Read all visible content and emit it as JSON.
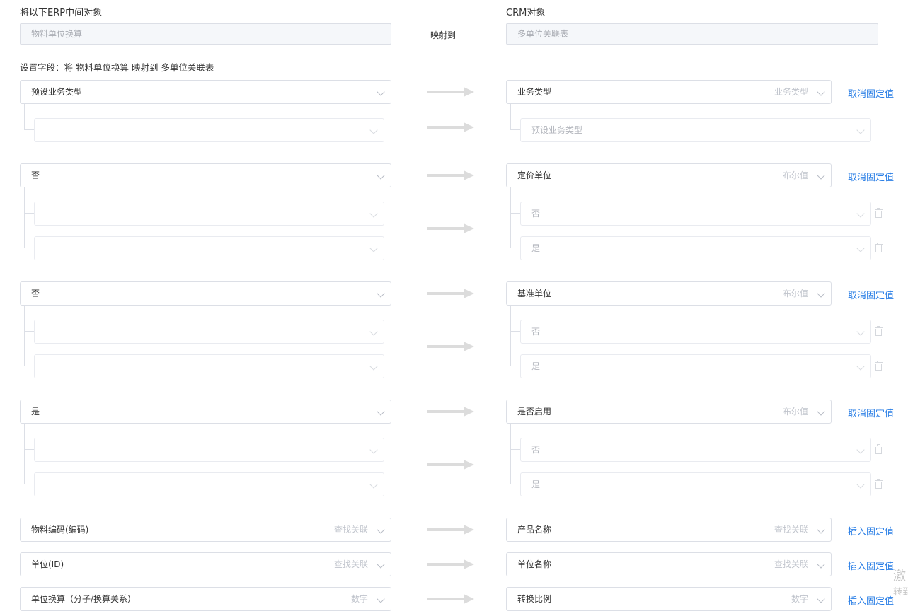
{
  "source_header": "将以下ERP中间对象",
  "target_header": "CRM对象",
  "source_object": "物料单位换算",
  "mapping_label": "映射到",
  "target_object": "多单位关联表",
  "setting_label": "设置字段：将 物料单位换算 映射到 多单位关联表",
  "rows": [
    {
      "source": {
        "value": "预设业务类型",
        "hint": ""
      },
      "target": {
        "value": "业务类型",
        "hint": "业务类型"
      },
      "action": "取消固定值",
      "sub_targets": [
        {
          "value": "预设业务类型",
          "deletable": false
        }
      ]
    },
    {
      "source": {
        "value": "否",
        "hint": ""
      },
      "target": {
        "value": "定价单位",
        "hint": "布尔值"
      },
      "action": "取消固定值",
      "sub_targets": [
        {
          "value": "否",
          "deletable": true
        },
        {
          "value": "是",
          "deletable": true
        }
      ]
    },
    {
      "source": {
        "value": "否",
        "hint": ""
      },
      "target": {
        "value": "基准单位",
        "hint": "布尔值"
      },
      "action": "取消固定值",
      "sub_targets": [
        {
          "value": "否",
          "deletable": true
        },
        {
          "value": "是",
          "deletable": true
        }
      ]
    },
    {
      "source": {
        "value": "是",
        "hint": ""
      },
      "target": {
        "value": "是否启用",
        "hint": "布尔值"
      },
      "action": "取消固定值",
      "sub_targets": [
        {
          "value": "否",
          "deletable": true
        },
        {
          "value": "是",
          "deletable": true
        }
      ]
    },
    {
      "source": {
        "value": "物料编码(编码)",
        "hint": "查找关联"
      },
      "target": {
        "value": "产品名称",
        "hint": "查找关联"
      },
      "action": "插入固定值",
      "sub_targets": []
    },
    {
      "source": {
        "value": "单位(ID)",
        "hint": "查找关联"
      },
      "target": {
        "value": "单位名称",
        "hint": "查找关联"
      },
      "action": "插入固定值",
      "sub_targets": []
    },
    {
      "source": {
        "value": "单位换算（分子/换算关系）",
        "hint": "数字"
      },
      "target": {
        "value": "转换比例",
        "hint": "数字"
      },
      "action": "插入固定值",
      "sub_targets": []
    }
  ],
  "watermark": [
    "激",
    "转到"
  ]
}
